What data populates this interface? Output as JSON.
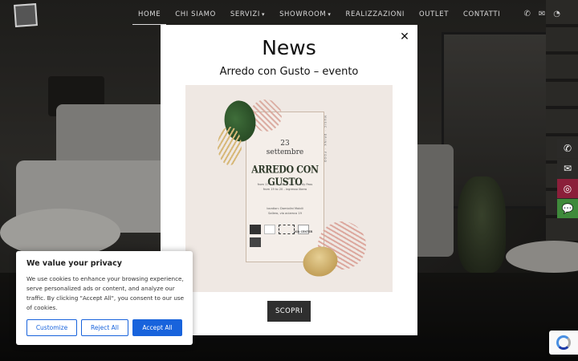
{
  "header": {
    "nav": [
      {
        "label": "HOME",
        "active": true,
        "caret": false
      },
      {
        "label": "CHI SIAMO",
        "active": false,
        "caret": false
      },
      {
        "label": "SERVIZI",
        "active": false,
        "caret": true
      },
      {
        "label": "SHOWROOM",
        "active": false,
        "caret": true
      },
      {
        "label": "REALIZZAZIONI",
        "active": false,
        "caret": false
      },
      {
        "label": "OUTLET",
        "active": false,
        "caret": false
      },
      {
        "label": "CONTATTI",
        "active": false,
        "caret": false
      }
    ],
    "icons": [
      "phone-icon",
      "mail-icon",
      "whatsapp-icon"
    ]
  },
  "side_bar": {
    "buttons": [
      {
        "name": "phone-icon",
        "glyph": "✆"
      },
      {
        "name": "mail-icon",
        "glyph": "✉"
      },
      {
        "name": "instagram-icon",
        "glyph": "◎"
      },
      {
        "name": "chat-icon",
        "glyph": "💬"
      }
    ]
  },
  "modal": {
    "title": "News",
    "subtitle": "Arredo con Gusto – evento",
    "close_glyph": "✕",
    "cta_label": "SCOPRI",
    "poster": {
      "day": "23",
      "month": "settembre",
      "event_name": "ARREDO CON GUSTO",
      "hours_line1": "from 17 to 19 - SOLD con Priority Pass",
      "hours_line2": "from 19 to 20 - ingresso libero",
      "location_line1": "location: Damiolini Mobili",
      "location_line2": "Sallero, via aciamco 19",
      "vertical_text": "MUSIC · DRINK · FOOD",
      "sponsor": "VIN CENTER"
    }
  },
  "cookie_banner": {
    "title": "We value your privacy",
    "text": "We use cookies to enhance your browsing experience, serve personalized ads or content, and analyze our traffic. By clicking \"Accept All\", you consent to our use of cookies.",
    "customize_label": "Customize",
    "reject_label": "Reject All",
    "accept_label": "Accept All",
    "accent_color": "#1863dc"
  }
}
